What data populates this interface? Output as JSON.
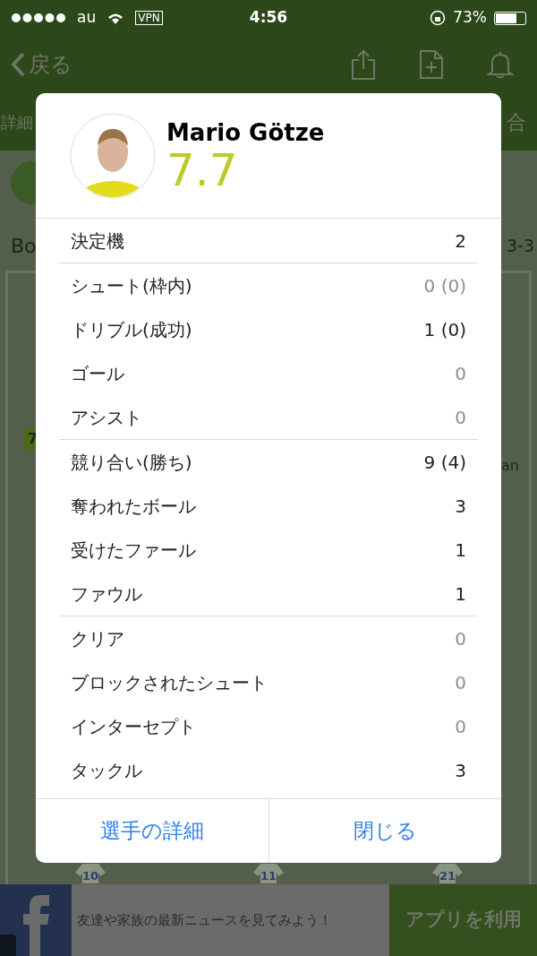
{
  "status_bar": {
    "carrier": "au",
    "vpn": "VPN",
    "time": "4:56",
    "battery": "73%"
  },
  "nav": {
    "back": "戻る"
  },
  "tabs": [
    {
      "label": "詳細"
    },
    {
      "label": "合"
    }
  ],
  "match": {
    "home": "Bo",
    "formation": "3-3"
  },
  "pitch": {
    "badge": "7",
    "name_fragment": "an",
    "players": [
      {
        "number": "10"
      },
      {
        "number": "11"
      },
      {
        "number": "21"
      }
    ]
  },
  "player": {
    "name": "Mario Götze",
    "rating": "7.7"
  },
  "stats": [
    {
      "label": "決定機",
      "value": "2",
      "zero": false,
      "divider_after": true
    },
    {
      "label": "シュート(枠内)",
      "value": "0 (0)",
      "zero": true,
      "divider_after": false
    },
    {
      "label": "ドリブル(成功)",
      "value": "1 (0)",
      "zero": false,
      "divider_after": false
    },
    {
      "label": "ゴール",
      "value": "0",
      "zero": true,
      "divider_after": false
    },
    {
      "label": "アシスト",
      "value": "0",
      "zero": true,
      "divider_after": true
    },
    {
      "label": "競り合い(勝ち)",
      "value": "9 (4)",
      "zero": false,
      "divider_after": false
    },
    {
      "label": "奪われたボール",
      "value": "3",
      "zero": false,
      "divider_after": false
    },
    {
      "label": "受けたファール",
      "value": "1",
      "zero": false,
      "divider_after": false
    },
    {
      "label": "ファウル",
      "value": "1",
      "zero": false,
      "divider_after": true
    },
    {
      "label": "クリア",
      "value": "0",
      "zero": true,
      "divider_after": false
    },
    {
      "label": "ブロックされたシュート",
      "value": "0",
      "zero": true,
      "divider_after": false
    },
    {
      "label": "インターセプト",
      "value": "0",
      "zero": true,
      "divider_after": false
    },
    {
      "label": "タックル",
      "value": "3",
      "zero": false,
      "divider_after": false
    }
  ],
  "buttons": [
    "選手の詳細",
    "閉じる"
  ],
  "ad": {
    "text": "友達や家族の最新ニュースを見てみよう！",
    "cta": "アプリを利用"
  }
}
